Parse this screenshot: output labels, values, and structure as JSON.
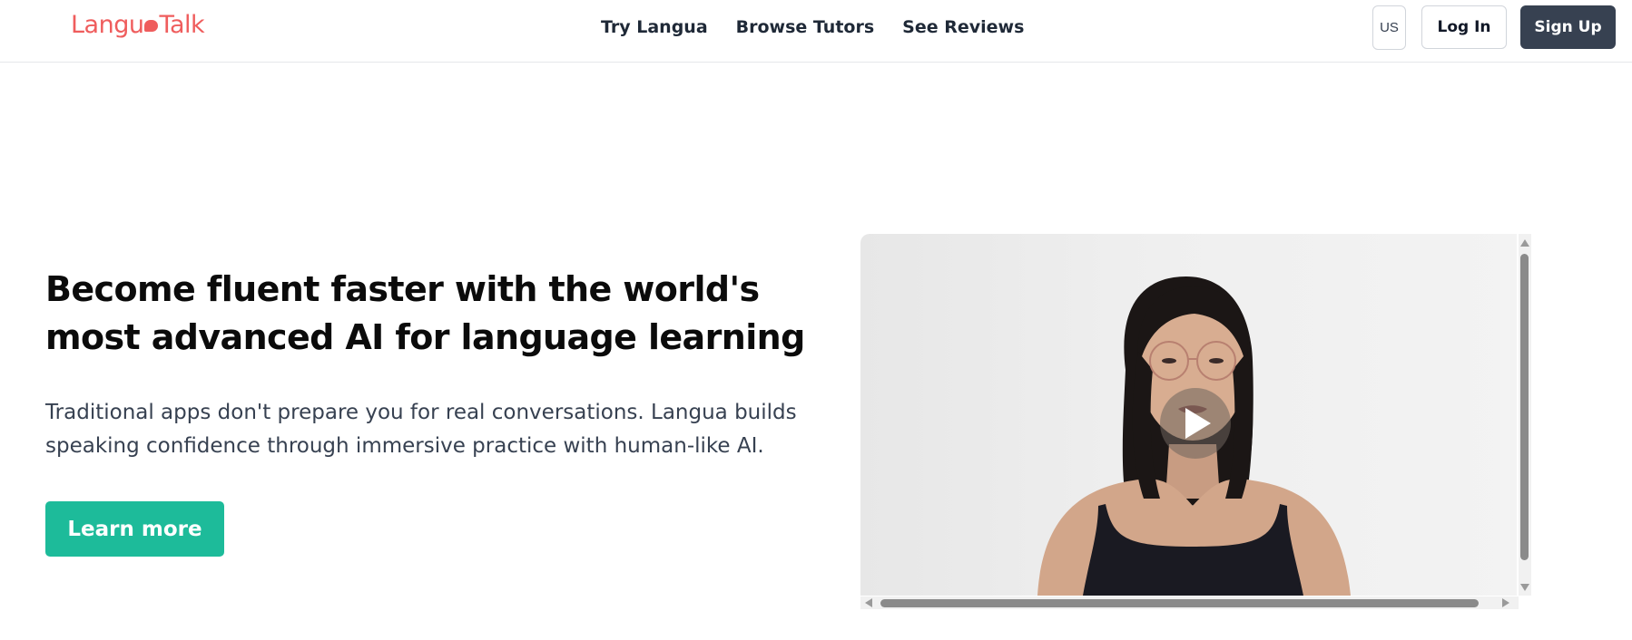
{
  "header": {
    "logo_left": "Langu",
    "logo_right": "Talk",
    "nav": [
      "Try Langua",
      "Browse Tutors",
      "See Reviews"
    ],
    "region": "US",
    "login_label": "Log In",
    "signup_label": "Sign Up"
  },
  "hero": {
    "title": "Become fluent faster with the world's most advanced AI for language learning",
    "subtitle": "Traditional apps don't prepare you for real conversations. Langua builds speaking confidence through immersive practice with human-like AI.",
    "cta_label": "Learn more"
  },
  "video": {
    "play_icon": "play-icon"
  },
  "colors": {
    "brand": "#ef5d5d",
    "cta": "#1dbb9a",
    "signup_bg": "#374151"
  }
}
